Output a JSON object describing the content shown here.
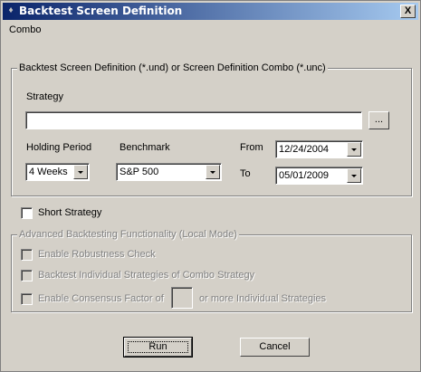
{
  "window": {
    "title": "Backtest Screen Definition",
    "close_glyph": "X"
  },
  "combo_label": "Combo",
  "definition_group": {
    "title": "Backtest Screen Definition (*.und) or Screen Definition Combo (*.unc)",
    "strategy_label": "Strategy",
    "strategy_value": "",
    "browse_label": "...",
    "holding_period_label": "Holding Period",
    "holding_period_value": "4 Weeks",
    "benchmark_label": "Benchmark",
    "benchmark_value": "S&P 500",
    "from_label": "From",
    "from_value": "12/24/2004",
    "to_label": "To",
    "to_value": "05/01/2009"
  },
  "short_strategy": {
    "label": "Short Strategy",
    "checked": false
  },
  "advanced_group": {
    "title": "Advanced Backtesting Functionality (Local Mode)",
    "robustness_label": "Enable Robustness Check",
    "individual_label": "Backtest Individual Strategies of Combo Strategy",
    "consensus_prefix": "Enable Consensus Factor of",
    "consensus_value": "",
    "consensus_suffix": "or more Individual Strategies"
  },
  "buttons": {
    "run": "Run",
    "cancel": "Cancel"
  }
}
